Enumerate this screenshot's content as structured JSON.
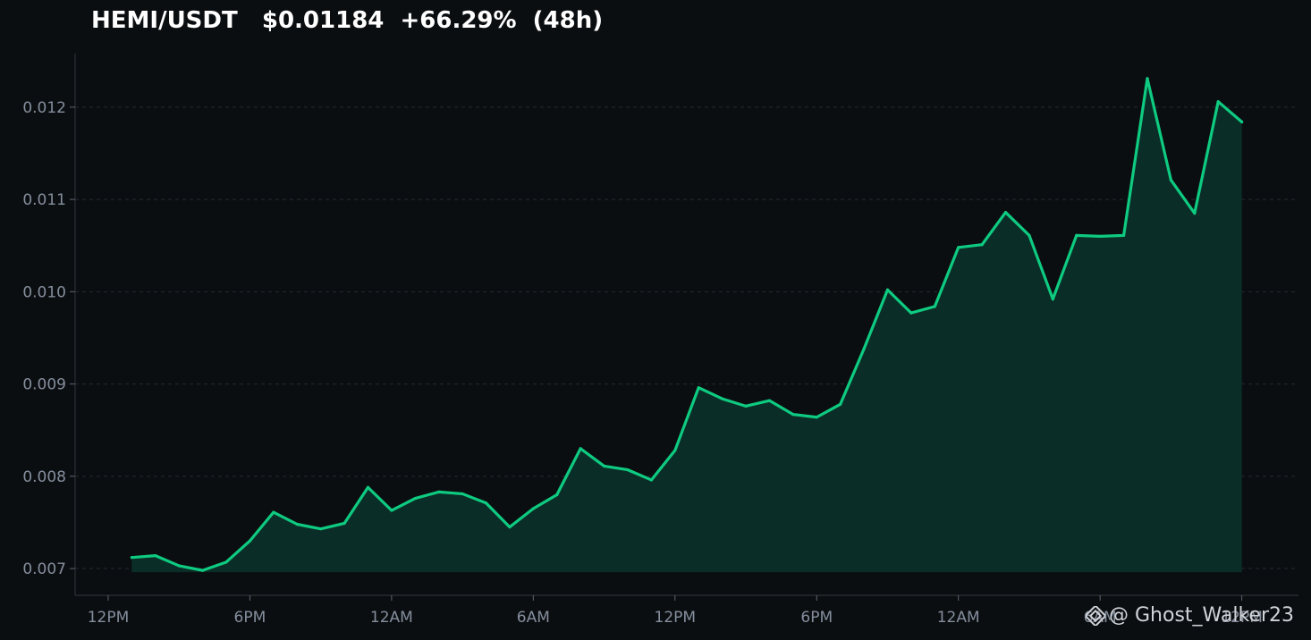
{
  "chart_data": {
    "type": "area",
    "title": "HEMI/USDT   $0.01184  +66.29%  (48h)",
    "xlabel": "",
    "ylabel": "",
    "x_tick_labels": [
      "12PM",
      "6PM",
      "12AM",
      "6AM",
      "12PM",
      "6PM",
      "12AM",
      "6AM",
      "12PM"
    ],
    "x_tick_hours": [
      0,
      6,
      12,
      18,
      24,
      30,
      36,
      42,
      48
    ],
    "y_ticks": [
      0.007,
      0.008,
      0.009,
      0.01,
      0.011,
      0.012
    ],
    "y_tick_labels": [
      "0.007",
      "0.008",
      "0.009",
      "0.010",
      "0.011",
      "0.012"
    ],
    "xlim": [
      -1.4,
      50.4
    ],
    "ylim": [
      0.00671,
      0.01258
    ],
    "grid": "horizontal dashed",
    "line_color": "#0ecb81",
    "fill_color": "#0a2e27",
    "series": [
      {
        "values": [
          0.00712,
          0.00714,
          0.00703,
          0.00698,
          0.00707,
          0.0073,
          0.00761,
          0.00748,
          0.00743,
          0.00749,
          0.00788,
          0.00763,
          0.00776,
          0.00783,
          0.00781,
          0.00771,
          0.00745,
          0.00765,
          0.0078,
          0.0083,
          0.00811,
          0.00807,
          0.00796,
          0.00828,
          0.00896,
          0.00884,
          0.00876,
          0.00882,
          0.00867,
          0.00864,
          0.00878,
          0.00938,
          0.01002,
          0.00977,
          0.00984,
          0.01048,
          0.01051,
          0.01086,
          0.01061,
          0.00992,
          0.01061,
          0.0106,
          0.01061,
          0.01231,
          0.01121,
          0.01085,
          0.01206,
          0.01184
        ],
        "x_start_hour": 1,
        "x_step_hours": 1
      }
    ]
  },
  "watermark": {
    "text": "@ Ghost_Walker23",
    "icon": "binance-logo-icon"
  }
}
